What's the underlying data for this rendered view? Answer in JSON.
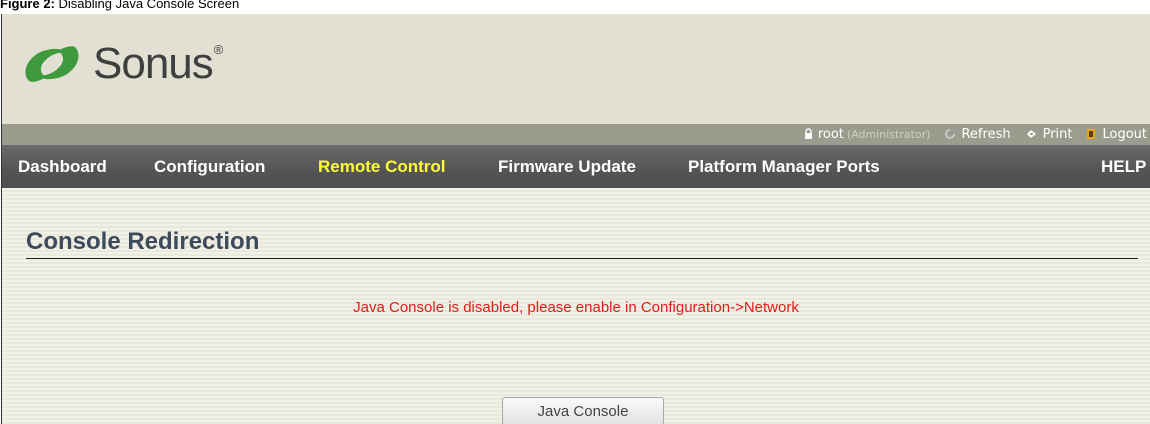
{
  "caption": {
    "prefix": "Figure 2:",
    "text": " Disabling Java Console Screen"
  },
  "logo": {
    "text": "Sonus",
    "reg": "®"
  },
  "userbar": {
    "user": "root",
    "role": "(Administrator)",
    "refresh": "Refresh",
    "print": "Print",
    "logout": "Logout"
  },
  "nav": {
    "items": [
      "Dashboard",
      "Configuration",
      "Remote Control",
      "Firmware Update",
      "Platform Manager Ports"
    ],
    "active": "Remote Control",
    "help": "HELP"
  },
  "main": {
    "title": "Console Redirection",
    "message": "Java Console is disabled, please enable in Configuration->Network",
    "button": "Java Console"
  },
  "colors": {
    "header_bg": "#e2e0d3",
    "nav_bg": "#585858",
    "nav_active": "#ffff33",
    "logo_green": "#3f9a3e",
    "message": "#e01b1b",
    "title": "#3d4a5c"
  }
}
